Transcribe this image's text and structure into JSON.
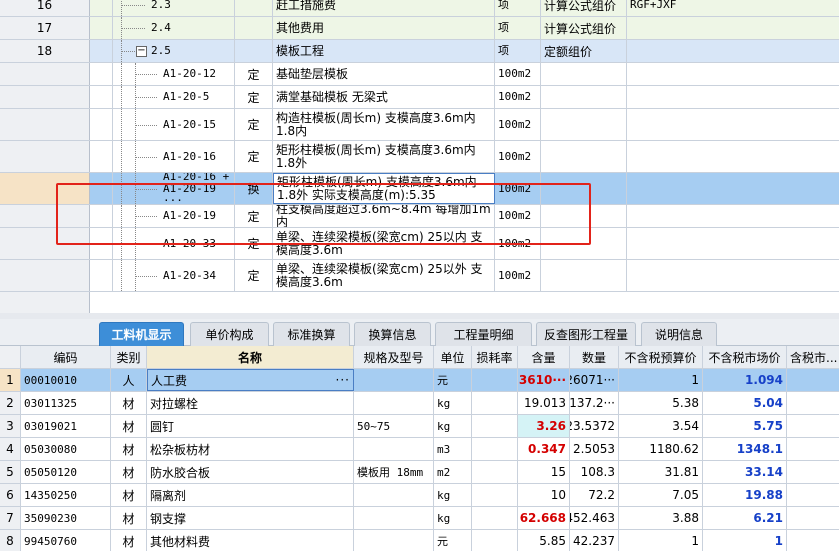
{
  "top_table": {
    "rows": [
      {
        "row": "16",
        "code": "2.3",
        "type": "",
        "name": "赶工措施费",
        "unit": "项",
        "expr_type": "计算公式组价",
        "calc": "RGF+JXF",
        "style": "green",
        "level": 1
      },
      {
        "row": "17",
        "code": "2.4",
        "type": "",
        "name": "其他费用",
        "unit": "项",
        "expr_type": "计算公式组价",
        "calc": "",
        "style": "green",
        "level": 1
      },
      {
        "row": "18",
        "code": "2.5",
        "type": "",
        "name": "模板工程",
        "unit": "项",
        "expr_type": "定额组价",
        "calc": "",
        "style": "blue",
        "level": 1,
        "collapse": "−"
      },
      {
        "row": "",
        "code": "A1-20-12",
        "type": "定",
        "name": "基础垫层模板",
        "unit": "100m2",
        "expr_type": "",
        "calc": "",
        "style": "",
        "level": 2
      },
      {
        "row": "",
        "code": "A1-20-5",
        "type": "定",
        "name": "满堂基础模板 无梁式",
        "unit": "100m2",
        "expr_type": "",
        "calc": "",
        "style": "",
        "level": 2
      },
      {
        "row": "",
        "code": "A1-20-15",
        "type": "定",
        "name": "构造柱模板(周长m) 支模高度3.6m内 1.8内",
        "unit": "100m2",
        "expr_type": "",
        "calc": "",
        "style": "",
        "level": 2
      },
      {
        "row": "",
        "code": "A1-20-16",
        "type": "定",
        "name": "矩形柱模板(周长m) 支模高度3.6m内 1.8外",
        "unit": "100m2",
        "expr_type": "",
        "calc": "",
        "style": "",
        "level": 2
      },
      {
        "row": "",
        "code": "A1-20-16 + A1-20-19 ···",
        "type": "换",
        "name": "矩形柱模板(周长m) 支模高度3.6m内 1.8外  实际支模高度(m):5.35",
        "unit": "100m2",
        "expr_type": "",
        "calc": "",
        "style": "sel",
        "level": 2
      },
      {
        "row": "",
        "code": "A1-20-19",
        "type": "定",
        "name": "柱支模高度超过3.6m~8.4m 每增加1m内",
        "unit": "100m2",
        "expr_type": "",
        "calc": "",
        "style": "",
        "level": 2
      },
      {
        "row": "",
        "code": "A1-20-33",
        "type": "定",
        "name": "单梁、连续梁模板(梁宽cm) 25以内 支模高度3.6m",
        "unit": "100m2",
        "expr_type": "",
        "calc": "",
        "style": "",
        "level": 2
      },
      {
        "row": "",
        "code": "A1-20-34",
        "type": "定",
        "name": "单梁、连续梁模板(梁宽cm) 25以外 支模高度3.6m",
        "unit": "100m2",
        "expr_type": "",
        "calc": "",
        "style": "",
        "level": 2
      }
    ]
  },
  "tabs": [
    {
      "label": "工料机显示",
      "active": true
    },
    {
      "label": "单价构成",
      "active": false
    },
    {
      "label": "标准换算",
      "active": false
    },
    {
      "label": "换算信息",
      "active": false
    },
    {
      "label": "工程量明细",
      "active": false
    },
    {
      "label": "反查图形工程量",
      "active": false
    },
    {
      "label": "说明信息",
      "active": false
    }
  ],
  "bottom_table": {
    "headers": {
      "code": "编码",
      "cat": "类别",
      "name": "名称",
      "spec": "规格及型号",
      "unit": "单位",
      "loss": "损耗率",
      "qty": "含量",
      "amount": "数量",
      "budget_price": "不含税预算价",
      "market_price": "不含税市场价",
      "market_price2": "含税市..."
    },
    "rows": [
      {
        "idx": "1",
        "code": "00010010",
        "cat": "人",
        "name": "人工费",
        "spec": "",
        "unit": "元",
        "loss": "",
        "qty": "3610···",
        "amount": "26071···",
        "budget": "1",
        "market": "1.094",
        "market2": "",
        "qty_style": "red",
        "selected": true
      },
      {
        "idx": "2",
        "code": "03011325",
        "cat": "材",
        "name": "对拉螺栓",
        "spec": "",
        "unit": "kg",
        "loss": "",
        "qty": "19.013",
        "amount": "137.2···",
        "budget": "5.38",
        "market": "5.04",
        "market2": "",
        "qty_style": ""
      },
      {
        "idx": "3",
        "code": "03019021",
        "cat": "材",
        "name": "圆钉",
        "spec": "50~75",
        "unit": "kg",
        "loss": "",
        "qty": "3.26",
        "amount": "23.5372",
        "budget": "3.54",
        "market": "5.75",
        "market2": "",
        "qty_style": "red cyan"
      },
      {
        "idx": "4",
        "code": "05030080",
        "cat": "材",
        "name": "松杂板枋材",
        "spec": "",
        "unit": "m3",
        "loss": "",
        "qty": "0.347",
        "amount": "2.5053",
        "budget": "1180.62",
        "market": "1348.1",
        "market2": "15",
        "qty_style": "red"
      },
      {
        "idx": "5",
        "code": "05050120",
        "cat": "材",
        "name": "防水胶合板",
        "spec": "模板用 18mm",
        "unit": "m2",
        "loss": "",
        "qty": "15",
        "amount": "108.3",
        "budget": "31.81",
        "market": "33.14",
        "market2": "",
        "qty_style": ""
      },
      {
        "idx": "6",
        "code": "14350250",
        "cat": "材",
        "name": "隔离剂",
        "spec": "",
        "unit": "kg",
        "loss": "",
        "qty": "10",
        "amount": "72.2",
        "budget": "7.05",
        "market": "19.88",
        "market2": "",
        "qty_style": ""
      },
      {
        "idx": "7",
        "code": "35090230",
        "cat": "材",
        "name": "钢支撑",
        "spec": "",
        "unit": "kg",
        "loss": "",
        "qty": "62.668",
        "amount": "452.463",
        "budget": "3.88",
        "market": "6.21",
        "market2": "",
        "qty_style": "red"
      },
      {
        "idx": "8",
        "code": "99450760",
        "cat": "材",
        "name": "其他材料费",
        "spec": "",
        "unit": "元",
        "loss": "",
        "qty": "5.85",
        "amount": "42.237",
        "budget": "1",
        "market": "1",
        "market2": "",
        "qty_style": ""
      }
    ]
  },
  "colors": {
    "highlight_border": "#e2231a",
    "selected_row": "#a6cdf2",
    "active_tab": "#3d8ed8",
    "value_red": "#d40000",
    "value_blue": "#1640c8"
  }
}
